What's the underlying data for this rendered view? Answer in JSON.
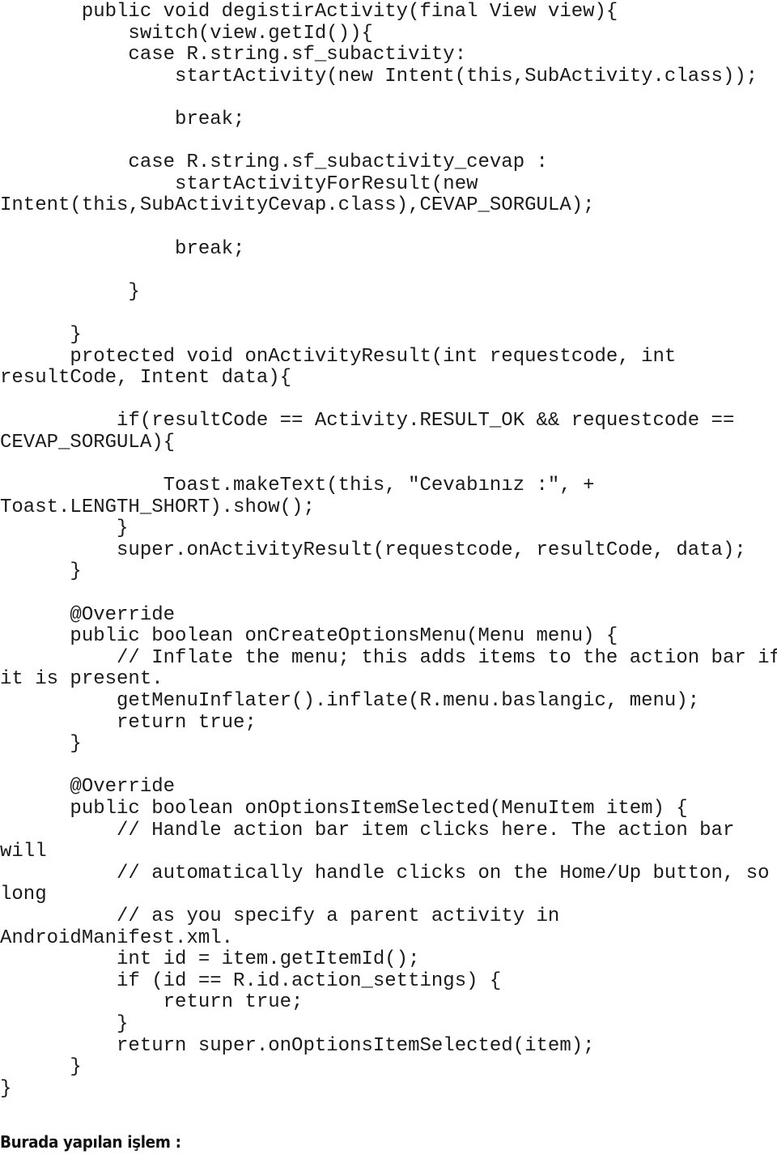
{
  "document": {
    "type": "source-code-listing",
    "language": "java",
    "background_color": "#ffffff",
    "text_color": "#1a1a1a"
  },
  "code": {
    "lines": [
      "       public void degistirActivity(final View view){",
      "           switch(view.getId()){",
      "           case R.string.sf_subactivity:",
      "               startActivity(new Intent(this,SubActivity.class));",
      "",
      "               break;",
      "",
      "           case R.string.sf_subactivity_cevap :",
      "               startActivityForResult(new",
      "Intent(this,SubActivityCevap.class),CEVAP_SORGULA);",
      "",
      "               break;",
      "",
      "           }",
      "",
      "      }",
      "      protected void onActivityResult(int requestcode, int",
      "resultCode, Intent data){",
      "",
      "          if(resultCode == Activity.RESULT_OK && requestcode ==",
      "CEVAP_SORGULA){",
      "",
      "              Toast.makeText(this, \"Cevabınız :\", +",
      "Toast.LENGTH_SHORT).show();",
      "          }",
      "          super.onActivityResult(requestcode, resultCode, data);",
      "      }",
      "",
      "      @Override",
      "      public boolean onCreateOptionsMenu(Menu menu) {",
      "          // Inflate the menu; this adds items to the action bar if",
      "it is present.",
      "          getMenuInflater().inflate(R.menu.baslangic, menu);",
      "          return true;",
      "      }",
      "",
      "      @Override",
      "      public boolean onOptionsItemSelected(MenuItem item) {",
      "          // Handle action bar item clicks here. The action bar",
      "will",
      "          // automatically handle clicks on the Home/Up button, so",
      "long",
      "          // as you specify a parent activity in",
      "AndroidManifest.xml.",
      "          int id = item.getItemId();",
      "          if (id == R.id.action_settings) {",
      "              return true;",
      "          }",
      "          return super.onOptionsItemSelected(item);",
      "      }",
      "}"
    ]
  },
  "caption": {
    "text": "Burada yapılan işlem :"
  }
}
